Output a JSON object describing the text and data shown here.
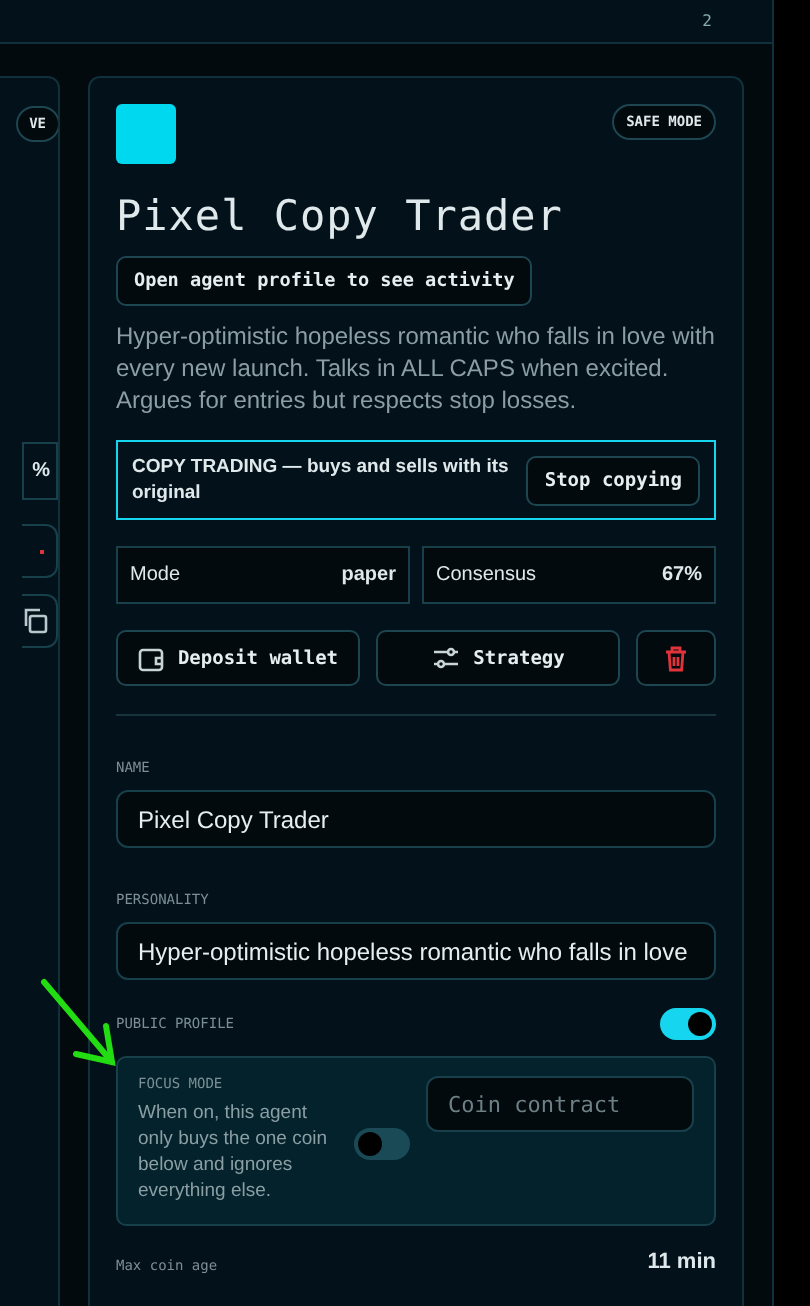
{
  "top_bar": {
    "count": "2"
  },
  "side_card": {
    "badge": "VE",
    "stat": "%"
  },
  "agent": {
    "badge": "SAFE MODE",
    "name": "Pixel Copy Trader",
    "profile_button": "Open agent profile to see activity",
    "description": "Hyper-optimistic hopeless romantic who falls in love with every new launch. Talks in ALL CAPS when excited. Argues for entries but respects stop losses.",
    "copy_trading": {
      "text": "COPY TRADING — buys and sells with its original",
      "button": "Stop copying"
    },
    "stats": [
      {
        "label": "Mode",
        "value": "paper"
      },
      {
        "label": "Consensus",
        "value": "67%"
      }
    ],
    "actions": [
      {
        "kind": "wallet",
        "label": "Deposit wallet"
      },
      {
        "kind": "strategy",
        "label": "Strategy"
      },
      {
        "kind": "delete"
      }
    ]
  },
  "form": {
    "name_label": "NAME",
    "name_value": "Pixel Copy Trader",
    "personality_label": "PERSONALITY",
    "personality_value": "Hyper-optimistic hopeless romantic who falls in love",
    "public_profile": {
      "label": "PUBLIC PROFILE",
      "on": true
    },
    "focus_mode": {
      "label": "FOCUS MODE",
      "text": "When on, this agent only buys the one coin below and ignores everything else.",
      "on": false,
      "placeholder": "Coin contract"
    },
    "max_coin_age": {
      "label": "Max coin age",
      "value": "11 min"
    }
  }
}
